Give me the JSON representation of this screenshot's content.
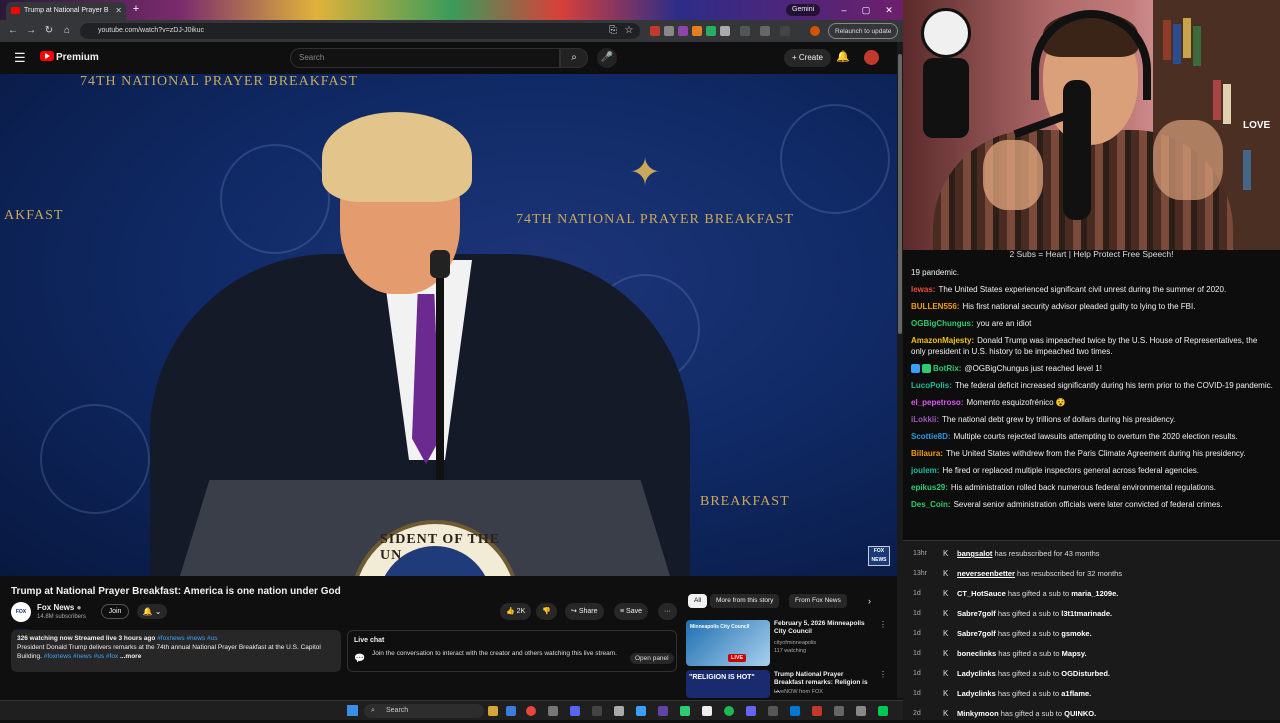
{
  "browser": {
    "tab": {
      "title": "Trump at National Prayer B",
      "new_tab": "+"
    },
    "gemini_label": "Gemini",
    "url": "youtube.com/watch?v=zDJ-J0ikuc",
    "relaunch_label": "Relaunch to update",
    "window_controls": [
      "–",
      "▢",
      "✕"
    ]
  },
  "youtube": {
    "logo_label": "Premium",
    "search_placeholder": "Search",
    "create_label": "Create",
    "video": {
      "title": "Trump at National Prayer Breakfast: America is one nation under God",
      "banner_text_top": "74TH NATIONAL PRAYER BREAKFAST",
      "banner_text_right": "74TH NATIONAL PRAYER BREAKFAST",
      "banner_text_left": "AKFAST",
      "banner_text_right2": "BREAKFAST",
      "seal_text": "SIDENT OF THE UN",
      "watermark": "FOX NEWS"
    },
    "channel": {
      "name": "Fox News",
      "subscribers": "14.8M subscribers",
      "logo_text": "FOX NEWS",
      "join_label": "Join"
    },
    "actions": {
      "likes": "2K",
      "share": "Share",
      "save": "Save",
      "more": "···"
    },
    "description": {
      "meta": "326 watching now  Streamed live 3 hours ago",
      "meta_tags": "#foxnews #news #us",
      "body": "President Donald Trump delivers remarks at the 74th annual National Prayer Breakfast at the U.S. Capitol Building.",
      "body_tags": "#foxnews #news #us #fox",
      "more": "...more"
    },
    "live_chat": {
      "title": "Live chat",
      "description": "Join the conversation to interact with the creator and others watching this live stream.",
      "open_panel": "Open panel"
    },
    "rec_chips": [
      "All",
      "More from this story",
      "From Fox News"
    ],
    "recommendations": [
      {
        "title": "February 5, 2026 Minneapolis City Council",
        "channel": "cityofminneapolis",
        "meta": "117 watching",
        "badge": "LIVE",
        "thumb_text": "Minneapolis City Council"
      },
      {
        "title": "Trump National Prayer Breakfast remarks: Religion is ...",
        "channel": "LiveNOW from FOX",
        "meta": "",
        "thumb_text": "\"RELIGION IS HOT\""
      }
    ]
  },
  "taskbar": {
    "search_label": "Search"
  },
  "webcam": {
    "sign_text": "LOVE"
  },
  "chat": {
    "header": "2 Subs = Heart | Help Protect Free Speech!",
    "messages": [
      {
        "user": "",
        "color": "#ffffff",
        "text": "19 pandemic."
      },
      {
        "user": "lewas:",
        "color": "#e74c3c",
        "text": "The United States experienced significant civil unrest during the summer of 2020."
      },
      {
        "user": "BULLEN556:",
        "color": "#f39c12",
        "text": "His first national security advisor pleaded guilty to lying to the FBI."
      },
      {
        "user": "OGBigChungus:",
        "color": "#2ecc71",
        "text": "you are an idiot"
      },
      {
        "user": "AmazonMajesty:",
        "color": "#f1c40f",
        "text": "Donald Trump was impeached twice by the U.S. House of Representatives, the only president in U.S. history to be impeached two times."
      },
      {
        "user": "BotRix:",
        "color": "#2ecc71",
        "text": "@OGBigChungus just reached level 1!",
        "badges": true
      },
      {
        "user": "LucoPolis:",
        "color": "#1abc9c",
        "text": "The federal deficit increased significantly during his term prior to the COVID-19 pandemic."
      },
      {
        "user": "el_pepetroso:",
        "color": "#e056fd",
        "text": "Momento esquizofrénico 😵"
      },
      {
        "user": "iLokkii:",
        "color": "#9b59b6",
        "text": "The national debt grew by trillions of dollars during his presidency."
      },
      {
        "user": "Scottie8D:",
        "color": "#3498db",
        "text": "Multiple courts rejected lawsuits attempting to overturn the 2020 election results."
      },
      {
        "user": "Billaura:",
        "color": "#f39c12",
        "text": "The United States withdrew from the Paris Climate Agreement during his presidency."
      },
      {
        "user": "joulem:",
        "color": "#1abc9c",
        "text": "He fired or replaced multiple inspectors general across federal agencies."
      },
      {
        "user": "epikus29:",
        "color": "#2ecc71",
        "text": "His administration rolled back numerous federal environmental regulations."
      },
      {
        "user": "Des_Coin:",
        "color": "#2ecc71",
        "text": "Several senior administration officials were later convicted of federal crimes."
      }
    ]
  },
  "events": [
    {
      "time": "13hr",
      "name": "bangsalot",
      "text": " has resubscribed for 43 months",
      "underline": true
    },
    {
      "time": "13hr",
      "name": "neverseenbetter",
      "text": " has resubscribed for 32 months",
      "underline": true
    },
    {
      "time": "1d",
      "name": "CT_HotSauce",
      "text": " has gifted a sub to ",
      "target": "maria_1209e."
    },
    {
      "time": "1d",
      "name": "Sabre7golf",
      "text": " has gifted a sub to ",
      "target": "l3t1tmarinade."
    },
    {
      "time": "1d",
      "name": "Sabre7golf",
      "text": " has gifted a sub to ",
      "target": "gsmoke."
    },
    {
      "time": "1d",
      "name": "boneclinks",
      "text": " has gifted a sub to ",
      "target": "Mapsy."
    },
    {
      "time": "1d",
      "name": "Ladyclinks",
      "text": " has gifted a sub to ",
      "target": "OGDisturbed."
    },
    {
      "time": "1d",
      "name": "Ladyclinks",
      "text": " has gifted a sub to ",
      "target": "a1flame."
    },
    {
      "time": "2d",
      "name": "Minkymoon",
      "text": " has gifted a sub to ",
      "target": "QUINKO."
    }
  ]
}
